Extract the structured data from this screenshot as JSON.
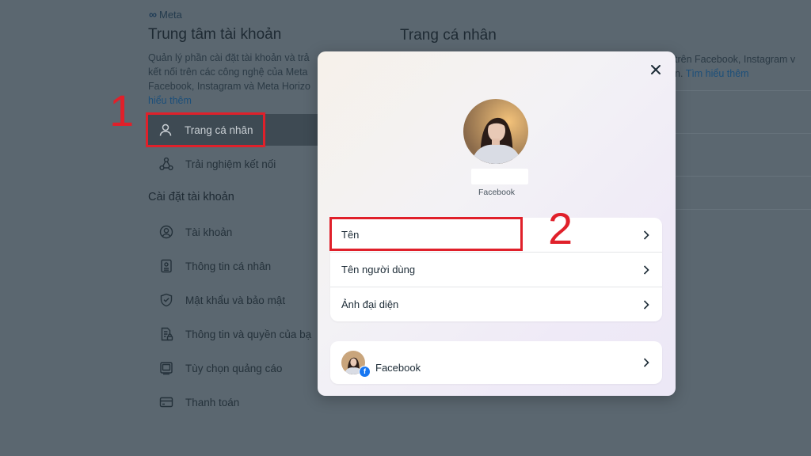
{
  "sidebar": {
    "brand": "Meta",
    "title": "Trung tâm tài khoản",
    "description": "Quản lý phần cài đặt tài khoản và trả\nkết nối trên các công nghệ của Meta\nFacebook, Instagram và Meta Horizo",
    "description_link": "hiểu thêm",
    "nav_items": [
      {
        "label": "Trang cá nhân",
        "icon": "person-icon",
        "active": true
      },
      {
        "label": "Trải nghiệm kết nối",
        "icon": "connected-nodes-icon",
        "active": false
      }
    ],
    "settings_title": "Cài đặt tài khoản",
    "settings_items": [
      {
        "label": "Tài khoản",
        "icon": "account-circle-icon"
      },
      {
        "label": "Thông tin cá nhân",
        "icon": "id-card-icon"
      },
      {
        "label": "Mật khẩu và bảo mật",
        "icon": "shield-icon"
      },
      {
        "label": "Thông tin và quyền của bạ",
        "icon": "document-lock-icon"
      },
      {
        "label": "Tùy chọn quảng cáo",
        "icon": "ad-monitor-icon"
      },
      {
        "label": "Thanh toán",
        "icon": "credit-card-icon"
      }
    ]
  },
  "main": {
    "title": "Trang cá nhân",
    "right_text": "trên Facebook, Instagram v\nn.",
    "right_link": "Tìm hiểu thêm"
  },
  "modal": {
    "profile_source": "Facebook",
    "rows": [
      {
        "label": "Tên"
      },
      {
        "label": "Tên người dùng"
      },
      {
        "label": "Ảnh đại diện"
      }
    ],
    "account": {
      "label": "Facebook"
    }
  },
  "annotations": {
    "step1": "1",
    "step2": "2"
  },
  "colors": {
    "annotation_red": "#e0202a",
    "facebook_blue": "#1877f2"
  }
}
